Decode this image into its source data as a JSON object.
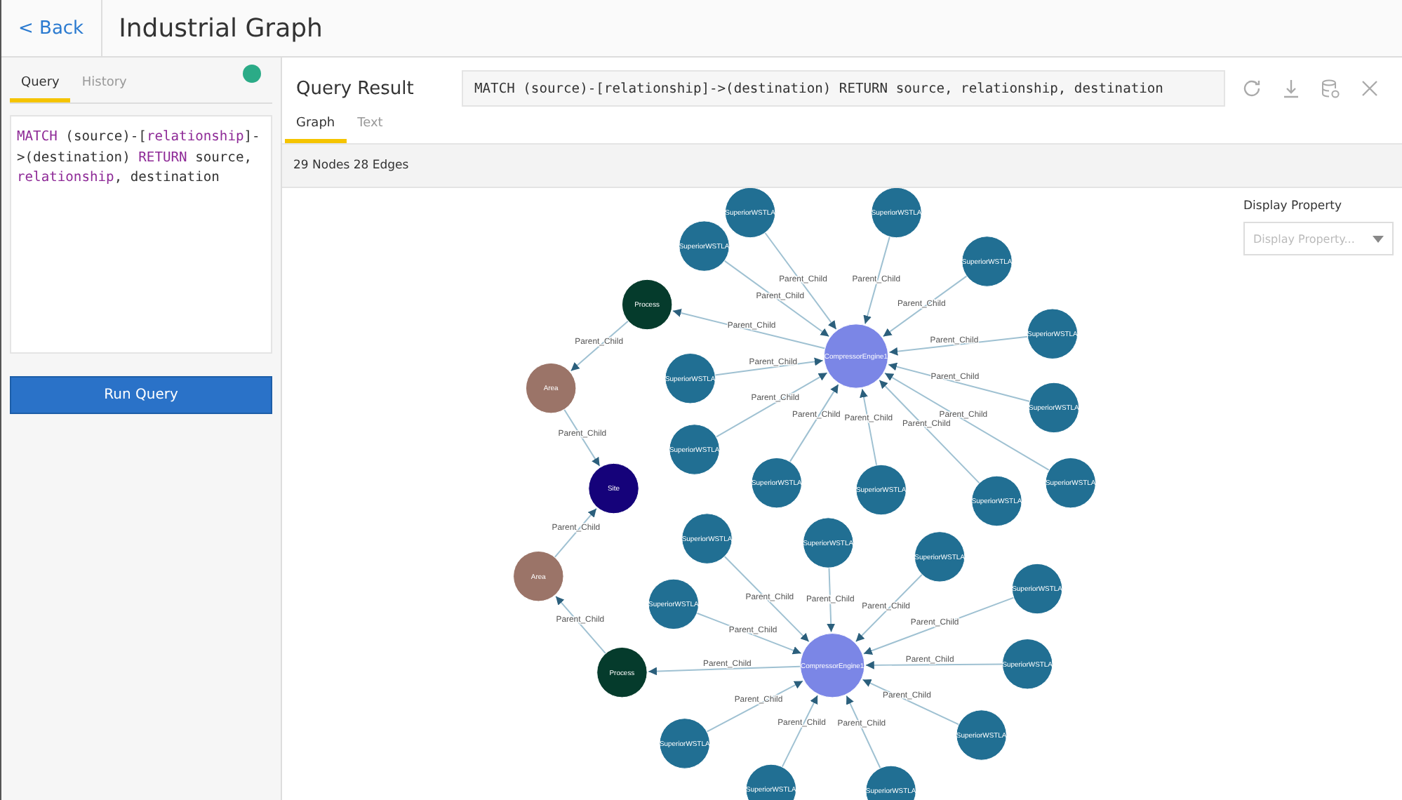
{
  "header": {
    "back": "< Back",
    "title": "Industrial Graph"
  },
  "left_panel": {
    "tabs": [
      {
        "label": "Query",
        "selected": true
      },
      {
        "label": "History",
        "selected": false
      }
    ],
    "status_dot": {
      "color": "#2bab87"
    },
    "editor": [
      {
        "text": "MATCH",
        "kind": "keyword"
      },
      {
        "text": " (source)-[",
        "kind": "plain"
      },
      {
        "text": "relationship",
        "kind": "keyword"
      },
      {
        "text": "]->(destination) ",
        "kind": "plain"
      },
      {
        "text": "RETURN",
        "kind": "keyword"
      },
      {
        "text": " source, ",
        "kind": "plain"
      },
      {
        "text": "relationship",
        "kind": "keyword"
      },
      {
        "text": ", destination",
        "kind": "plain"
      }
    ],
    "run_button": "Run Query"
  },
  "result": {
    "title": "Query Result",
    "query": "MATCH (source)-[relationship]->(destination) RETURN source, relationship, destination",
    "tabs": [
      {
        "label": "Graph",
        "selected": true
      },
      {
        "label": "Text",
        "selected": false
      }
    ],
    "stats": "29 Nodes 28 Edges",
    "display_property": {
      "label": "Display Property",
      "placeholder": "Display Property..."
    },
    "graph": {
      "site": {
        "label": "Site",
        "color": "#15027a"
      },
      "branches": [
        {
          "area": {
            "label": "Area",
            "color": "#9b7468",
            "edge_label": "Parent_Child"
          },
          "process": {
            "label": "Process",
            "color": "#053b2c",
            "edge_label": "Parent_Child"
          },
          "hub": {
            "label": "CompressorEngine1",
            "color": "#7b86e6",
            "edge_label": "Parent_Child"
          },
          "leaves": [
            {
              "label": "SuperiorWSTLA",
              "color": "#216f93",
              "edge_label": "Parent_Child"
            },
            {
              "label": "SuperiorWSTLA",
              "color": "#216f93",
              "edge_label": "Parent_Child"
            },
            {
              "label": "SuperiorWSTLA",
              "color": "#216f93",
              "edge_label": "Parent_Child"
            },
            {
              "label": "SuperiorWSTLA",
              "color": "#216f93",
              "edge_label": "Parent_Child"
            },
            {
              "label": "SuperiorWSTLA",
              "color": "#216f93",
              "edge_label": "Parent_Child"
            },
            {
              "label": "SuperiorWSTLA",
              "color": "#216f93",
              "edge_label": "Parent_Child"
            },
            {
              "label": "SuperiorWSTLA",
              "color": "#216f93",
              "edge_label": "Parent_Child"
            },
            {
              "label": "SuperiorWSTLA",
              "color": "#216f93",
              "edge_label": "Parent_Child"
            },
            {
              "label": "SuperiorWSTLA",
              "color": "#216f93",
              "edge_label": "Parent_Child"
            },
            {
              "label": "SuperiorWSTLA",
              "color": "#216f93",
              "edge_label": "Parent_Child"
            },
            {
              "label": "SuperiorWSTLA",
              "color": "#216f93",
              "edge_label": "Parent_Child"
            },
            {
              "label": "SuperiorWSTLA",
              "color": "#216f93",
              "edge_label": "Parent_Child"
            }
          ]
        },
        {
          "area": {
            "label": "Area",
            "color": "#9b7468",
            "edge_label": "Parent_Child"
          },
          "process": {
            "label": "Process",
            "color": "#053b2c",
            "edge_label": "Parent_Child"
          },
          "hub": {
            "label": "CompressorEngine1",
            "color": "#7b86e6",
            "edge_label": "Parent_Child"
          },
          "leaves": [
            {
              "label": "SuperiorWSTLA",
              "color": "#216f93",
              "edge_label": "Parent_Child"
            },
            {
              "label": "SuperiorWSTLA",
              "color": "#216f93",
              "edge_label": "Parent_Child"
            },
            {
              "label": "SuperiorWSTLA",
              "color": "#216f93",
              "edge_label": "Parent_Child"
            },
            {
              "label": "SuperiorWSTLA",
              "color": "#216f93",
              "edge_label": "Parent_Child"
            },
            {
              "label": "SuperiorWSTLA",
              "color": "#216f93",
              "edge_label": "Parent_Child"
            },
            {
              "label": "SuperiorWSTLA",
              "color": "#216f93",
              "edge_label": "Parent_Child"
            },
            {
              "label": "SuperiorWSTLA",
              "color": "#216f93",
              "edge_label": "Parent_Child"
            },
            {
              "label": "SuperiorWSTLA",
              "color": "#216f93",
              "edge_label": "Parent_Child"
            },
            {
              "label": "SuperiorWSTLA",
              "color": "#216f93",
              "edge_label": "Parent_Child"
            },
            {
              "label": "SuperiorWSTLA",
              "color": "#216f93",
              "edge_label": "Parent_Child"
            }
          ]
        }
      ]
    }
  }
}
